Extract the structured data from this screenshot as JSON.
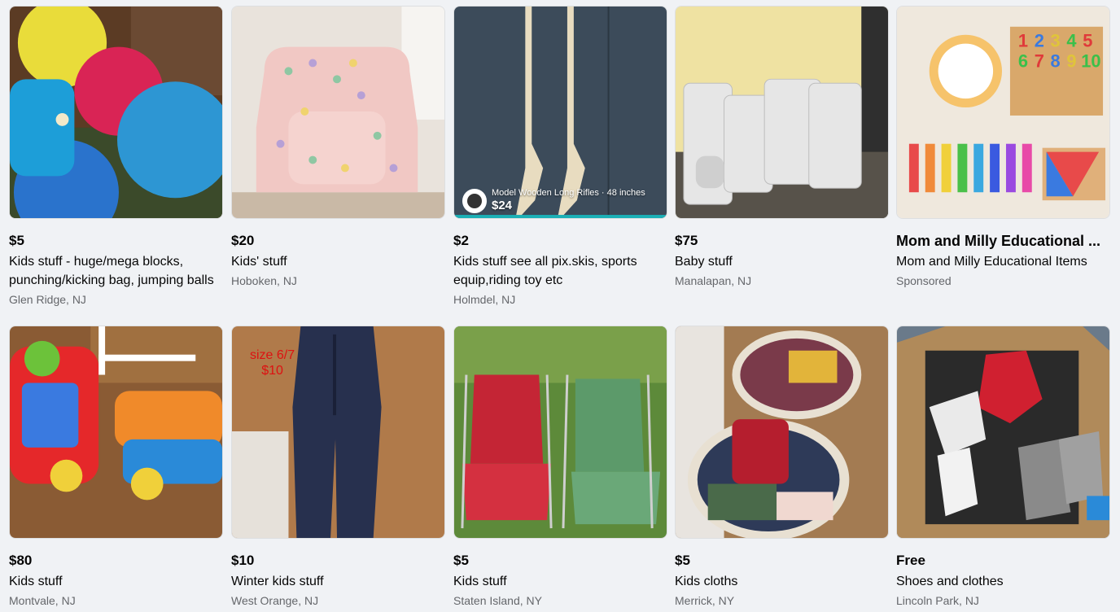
{
  "listings": [
    {
      "price": "$5",
      "title": "Kids stuff - huge/mega blocks, punching/kicking bag, jumping balls",
      "location": "Glen Ridge, NJ",
      "image_icon": "toy-balls-image"
    },
    {
      "price": "$20",
      "title": "Kids' stuff",
      "location": "Hoboken, NJ",
      "image_icon": "kids-chair-image"
    },
    {
      "price": "$2",
      "title": "Kids stuff see all pix.skis, sports equip,riding toy etc",
      "location": "Holmdel, NJ",
      "image_icon": "wooden-rifles-image",
      "overlay": {
        "caption": "Model Wooden Long Rifles · 48 inches",
        "price": "$24"
      }
    },
    {
      "price": "$75",
      "title": "Baby stuff",
      "location": "Manalapan, NJ",
      "image_icon": "baby-gate-image"
    },
    {
      "price": "Mom and Milly Educational ...",
      "title": "Mom and Milly Educational Items",
      "location": "Sponsored",
      "image_icon": "educational-toys-image"
    },
    {
      "price": "$80",
      "title": "Kids stuff",
      "location": "Montvale, NJ",
      "image_icon": "ride-on-toy-image"
    },
    {
      "price": "$10",
      "title": "Winter kids stuff",
      "location": "West Orange, NJ",
      "image_icon": "snow-pants-image",
      "overlay": {
        "line1": "size 6/7",
        "line2": "$10"
      }
    },
    {
      "price": "$5",
      "title": "Kids stuff",
      "location": "Staten Island, NY",
      "image_icon": "camp-chairs-image"
    },
    {
      "price": "$5",
      "title": "Kids cloths",
      "location": "Merrick, NY",
      "image_icon": "clothes-baskets-image"
    },
    {
      "price": "Free",
      "title": "Shoes and clothes",
      "location": "Lincoln Park, NJ",
      "image_icon": "shoes-box-image"
    }
  ],
  "colors": {
    "background": "#f0f2f5",
    "text": "#050505",
    "secondary_text": "#65676b",
    "overlay_red": "#dd1111"
  }
}
